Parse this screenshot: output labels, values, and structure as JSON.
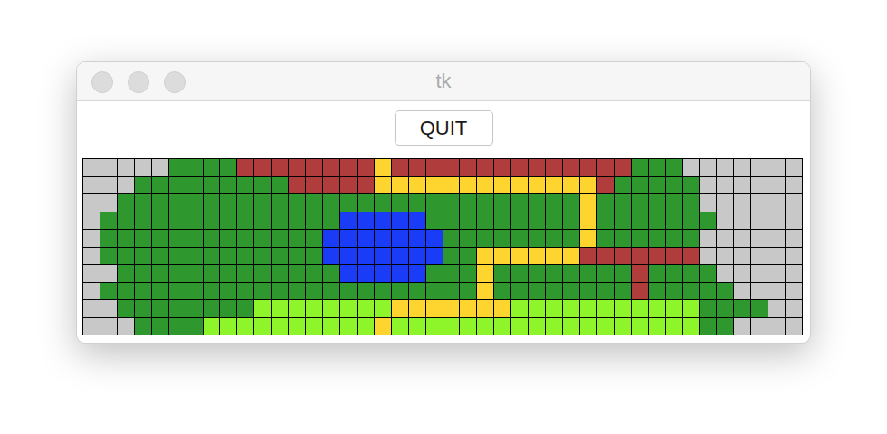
{
  "window": {
    "title": "tk"
  },
  "buttons": [
    "QUIT"
  ],
  "grid": {
    "palette": {
      "s": "#c8c8c8",
      "g": "#2e972e",
      "r": "#b03c3c",
      "y": "#fdd52e",
      "b": "#1a3cf7",
      "l": "#8ef52a"
    },
    "rows": [
      "sssssggggrrrrrrrryrrrrrrrrrrrrrrgggsssss",
      "sssgggggggggrrrrryyyyyyyyyyyyyrgggggssss",
      "ssgggggggggggggggggggggggggggyggggggssss",
      "sggggggggggggggbbbbbgggggggggygggggggsss",
      "sgggggggggggggbbbbbbbggggggggyggggggssss",
      "sgggggggggggggbbbbbbbggyyyyyyrrrrrrrssss",
      "ssgggggggggggggbbbbbgggyggggggggrggggsss",
      "sggggggggggggggggggggggyggggggggrgggggss",
      "ssggggggggllllllllyyyyyyylllllllllllggggss",
      "sssggggllllllllllyllllllllllllllllllggss"
    ]
  }
}
